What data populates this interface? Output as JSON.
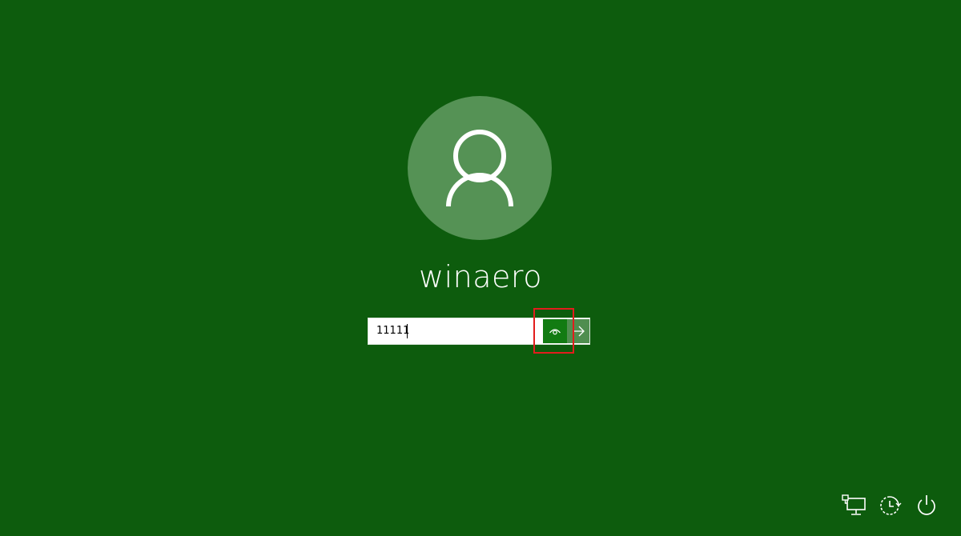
{
  "user": {
    "name": "winaero"
  },
  "password": {
    "value": "11111",
    "reveal_icon": "eye-icon",
    "submit_icon": "arrow-right-icon"
  },
  "system_icons": [
    {
      "name": "network-icon"
    },
    {
      "name": "ease-of-access-icon"
    },
    {
      "name": "power-icon"
    }
  ],
  "colors": {
    "background": "#0d5c0d",
    "avatar": "#559255",
    "reveal_button": "#127b12",
    "submit_button": "#4f8e4f",
    "highlight": "#e21d1d"
  }
}
